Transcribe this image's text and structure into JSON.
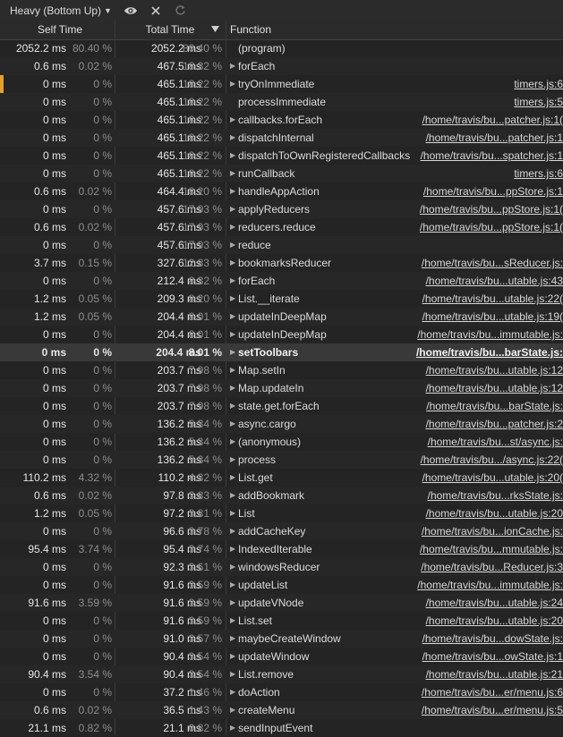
{
  "toolbar": {
    "view_label": "Heavy (Bottom Up)",
    "icons": [
      "eye-icon",
      "close-icon",
      "reload-icon"
    ]
  },
  "columns": {
    "self": "Self Time",
    "total": "Total Time",
    "function": "Function"
  },
  "colors": {
    "background": "#242424",
    "selected_row": "#393939",
    "marker": "#e8a02a"
  },
  "rows": [
    {
      "self": "2052.2 ms",
      "self_pct": "80.40 %",
      "total": "2052.2 ms",
      "total_pct": "80.40 %",
      "expand": "",
      "name": "(program)",
      "url": ""
    },
    {
      "self": "0.6 ms",
      "self_pct": "0.02 %",
      "total": "467.5 ms",
      "total_pct": "18.32 %",
      "expand": "▶",
      "name": "forEach",
      "url": ""
    },
    {
      "self": "0 ms",
      "self_pct": "0 %",
      "total": "465.1 ms",
      "total_pct": "18.22 %",
      "expand": "▶",
      "name": "tryOnImmediate",
      "url": "timers.js:6"
    },
    {
      "self": "0 ms",
      "self_pct": "0 %",
      "total": "465.1 ms",
      "total_pct": "18.22 %",
      "expand": "",
      "name": "processImmediate",
      "url": "timers.js:5"
    },
    {
      "self": "0 ms",
      "self_pct": "0 %",
      "total": "465.1 ms",
      "total_pct": "18.22 %",
      "expand": "▶",
      "name": "callbacks.forEach",
      "url": "/home/travis/bu...patcher.js:1("
    },
    {
      "self": "0 ms",
      "self_pct": "0 %",
      "total": "465.1 ms",
      "total_pct": "18.22 %",
      "expand": "▶",
      "name": "dispatchInternal",
      "url": "/home/travis/bu...patcher.js:1"
    },
    {
      "self": "0 ms",
      "self_pct": "0 %",
      "total": "465.1 ms",
      "total_pct": "18.22 %",
      "expand": "▶",
      "name": "dispatchToOwnRegisteredCallbacks",
      "url": "/home/travis/bu...spatcher.js:1"
    },
    {
      "self": "0 ms",
      "self_pct": "0 %",
      "total": "465.1 ms",
      "total_pct": "18.22 %",
      "expand": "▶",
      "name": "runCallback",
      "url": "timers.js:6"
    },
    {
      "self": "0.6 ms",
      "self_pct": "0.02 %",
      "total": "464.4 ms",
      "total_pct": "18.20 %",
      "expand": "▶",
      "name": "handleAppAction",
      "url": "/home/travis/bu...ppStore.js:1"
    },
    {
      "self": "0 ms",
      "self_pct": "0 %",
      "total": "457.6 ms",
      "total_pct": "17.93 %",
      "expand": "▶",
      "name": "applyReducers",
      "url": "/home/travis/bu...ppStore.js:1("
    },
    {
      "self": "0.6 ms",
      "self_pct": "0.02 %",
      "total": "457.6 ms",
      "total_pct": "17.93 %",
      "expand": "▶",
      "name": "reducers.reduce",
      "url": "/home/travis/bu...ppStore.js:1("
    },
    {
      "self": "0 ms",
      "self_pct": "0 %",
      "total": "457.6 ms",
      "total_pct": "17.93 %",
      "expand": "▶",
      "name": "reduce",
      "url": ""
    },
    {
      "self": "3.7 ms",
      "self_pct": "0.15 %",
      "total": "327.6 ms",
      "total_pct": "12.83 %",
      "expand": "▶",
      "name": "bookmarksReducer",
      "url": "/home/travis/bu...sReducer.js:"
    },
    {
      "self": "0 ms",
      "self_pct": "0 %",
      "total": "212.4 ms",
      "total_pct": "8.32 %",
      "expand": "▶",
      "name": "forEach",
      "url": "/home/travis/bu...utable.js:43"
    },
    {
      "self": "1.2 ms",
      "self_pct": "0.05 %",
      "total": "209.3 ms",
      "total_pct": "8.20 %",
      "expand": "▶",
      "name": "List.__iterate",
      "url": "/home/travis/bu...utable.js:22("
    },
    {
      "self": "1.2 ms",
      "self_pct": "0.05 %",
      "total": "204.4 ms",
      "total_pct": "8.01 %",
      "expand": "▶",
      "name": "updateInDeepMap",
      "url": "/home/travis/bu...utable.js:19("
    },
    {
      "self": "0 ms",
      "self_pct": "0 %",
      "total": "204.4 ms",
      "total_pct": "8.01 %",
      "expand": "▶",
      "name": "updateInDeepMap",
      "url": "/home/travis/bu...immutable.js:"
    },
    {
      "self": "0 ms",
      "self_pct": "0 %",
      "total": "204.4 ms",
      "total_pct": "8.01 %",
      "expand": "▶",
      "name": "setToolbars",
      "url": "/home/travis/bu...barState.js:"
    },
    {
      "self": "0 ms",
      "self_pct": "0 %",
      "total": "203.7 ms",
      "total_pct": "7.98 %",
      "expand": "▶",
      "name": "Map.setIn",
      "url": "/home/travis/bu...utable.js:12"
    },
    {
      "self": "0 ms",
      "self_pct": "0 %",
      "total": "203.7 ms",
      "total_pct": "7.98 %",
      "expand": "▶",
      "name": "Map.updateIn",
      "url": "/home/travis/bu...utable.js:12"
    },
    {
      "self": "0 ms",
      "self_pct": "0 %",
      "total": "203.7 ms",
      "total_pct": "7.98 %",
      "expand": "▶",
      "name": "state.get.forEach",
      "url": "/home/travis/bu...barState.js:"
    },
    {
      "self": "0 ms",
      "self_pct": "0 %",
      "total": "136.2 ms",
      "total_pct": "5.34 %",
      "expand": "▶",
      "name": "async.cargo",
      "url": "/home/travis/bu...patcher.js:2"
    },
    {
      "self": "0 ms",
      "self_pct": "0 %",
      "total": "136.2 ms",
      "total_pct": "5.34 %",
      "expand": "▶",
      "name": "(anonymous)",
      "url": "/home/travis/bu...st/async.js:"
    },
    {
      "self": "0 ms",
      "self_pct": "0 %",
      "total": "136.2 ms",
      "total_pct": "5.34 %",
      "expand": "▶",
      "name": "process",
      "url": "/home/travis/bu.../async.js:22("
    },
    {
      "self": "110.2 ms",
      "self_pct": "4.32 %",
      "total": "110.2 ms",
      "total_pct": "4.32 %",
      "expand": "▶",
      "name": "List.get",
      "url": "/home/travis/bu...utable.js:20("
    },
    {
      "self": "0.6 ms",
      "self_pct": "0.02 %",
      "total": "97.8 ms",
      "total_pct": "3.83 %",
      "expand": "▶",
      "name": "addBookmark",
      "url": "/home/travis/bu...rksState.js:"
    },
    {
      "self": "1.2 ms",
      "self_pct": "0.05 %",
      "total": "97.2 ms",
      "total_pct": "3.81 %",
      "expand": "▶",
      "name": "List",
      "url": "/home/travis/bu...utable.js:20"
    },
    {
      "self": "0 ms",
      "self_pct": "0 %",
      "total": "96.6 ms",
      "total_pct": "3.78 %",
      "expand": "▶",
      "name": "addCacheKey",
      "url": "/home/travis/bu...ionCache.js:"
    },
    {
      "self": "95.4 ms",
      "self_pct": "3.74 %",
      "total": "95.4 ms",
      "total_pct": "3.74 %",
      "expand": "▶",
      "name": "IndexedIterable",
      "url": "/home/travis/bu...mmutable.js:"
    },
    {
      "self": "0 ms",
      "self_pct": "0 %",
      "total": "92.3 ms",
      "total_pct": "3.61 %",
      "expand": "▶",
      "name": "windowsReducer",
      "url": "/home/travis/bu...Reducer.js:3"
    },
    {
      "self": "0 ms",
      "self_pct": "0 %",
      "total": "91.6 ms",
      "total_pct": "3.59 %",
      "expand": "▶",
      "name": "updateList",
      "url": "/home/travis/bu...immutable.js:"
    },
    {
      "self": "91.6 ms",
      "self_pct": "3.59 %",
      "total": "91.6 ms",
      "total_pct": "3.59 %",
      "expand": "▶",
      "name": "updateVNode",
      "url": "/home/travis/bu...utable.js:24"
    },
    {
      "self": "0 ms",
      "self_pct": "0 %",
      "total": "91.6 ms",
      "total_pct": "3.59 %",
      "expand": "▶",
      "name": "List.set",
      "url": "/home/travis/bu...utable.js:20"
    },
    {
      "self": "0 ms",
      "self_pct": "0 %",
      "total": "91.0 ms",
      "total_pct": "3.57 %",
      "expand": "▶",
      "name": "maybeCreateWindow",
      "url": "/home/travis/bu...dowState.js:"
    },
    {
      "self": "0 ms",
      "self_pct": "0 %",
      "total": "90.4 ms",
      "total_pct": "3.54 %",
      "expand": "▶",
      "name": "updateWindow",
      "url": "/home/travis/bu...owState.js:1"
    },
    {
      "self": "90.4 ms",
      "self_pct": "3.54 %",
      "total": "90.4 ms",
      "total_pct": "3.54 %",
      "expand": "▶",
      "name": "List.remove",
      "url": "/home/travis/bu...utable.js:21"
    },
    {
      "self": "0 ms",
      "self_pct": "0 %",
      "total": "37.2 ms",
      "total_pct": "1.46 %",
      "expand": "▶",
      "name": "doAction",
      "url": "/home/travis/bu...er/menu.js:6"
    },
    {
      "self": "0.6 ms",
      "self_pct": "0.02 %",
      "total": "36.5 ms",
      "total_pct": "1.43 %",
      "expand": "▶",
      "name": "createMenu",
      "url": "/home/travis/bu...er/menu.js:5"
    },
    {
      "self": "21.1 ms",
      "self_pct": "0.82 %",
      "total": "21.1 ms",
      "total_pct": "0.82 %",
      "expand": "▶",
      "name": "sendInputEvent",
      "url": ""
    }
  ],
  "selected_row_index": 17,
  "marked_row_index": 2
}
